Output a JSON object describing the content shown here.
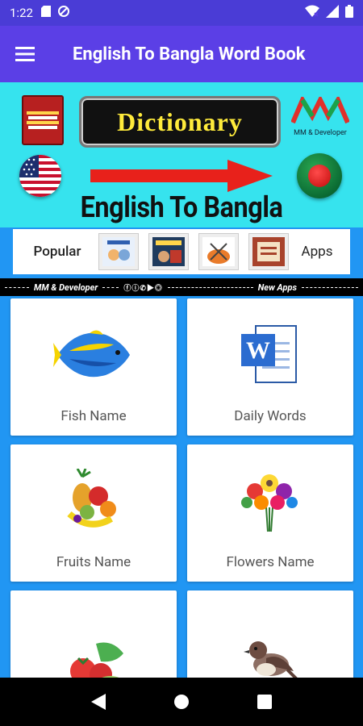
{
  "status_bar": {
    "time": "1:22"
  },
  "app_bar": {
    "title": "English To Bangla Word Book"
  },
  "banner": {
    "dictionary_text": "Dictionary",
    "subtitle": "English To Bangla",
    "brand_text": "MM & Developer"
  },
  "popular": {
    "left_label": "Popular",
    "right_label": "Apps"
  },
  "ticker": {
    "left_text": "MM & Developer",
    "right_text": "New Apps"
  },
  "cards": [
    {
      "label": "Fish Name",
      "icon": "fish-icon"
    },
    {
      "label": "Daily Words",
      "icon": "word-document-icon"
    },
    {
      "label": "Fruits Name",
      "icon": "fruits-icon"
    },
    {
      "label": "Flowers Name",
      "icon": "flowers-icon"
    },
    {
      "label": "",
      "icon": "vegetables-icon"
    },
    {
      "label": "",
      "icon": "bird-icon"
    }
  ],
  "colors": {
    "status": "#4a3cd6",
    "app_bar": "#5b3fe6",
    "banner": "#36e3ee",
    "grid_bg": "#2196f3"
  }
}
